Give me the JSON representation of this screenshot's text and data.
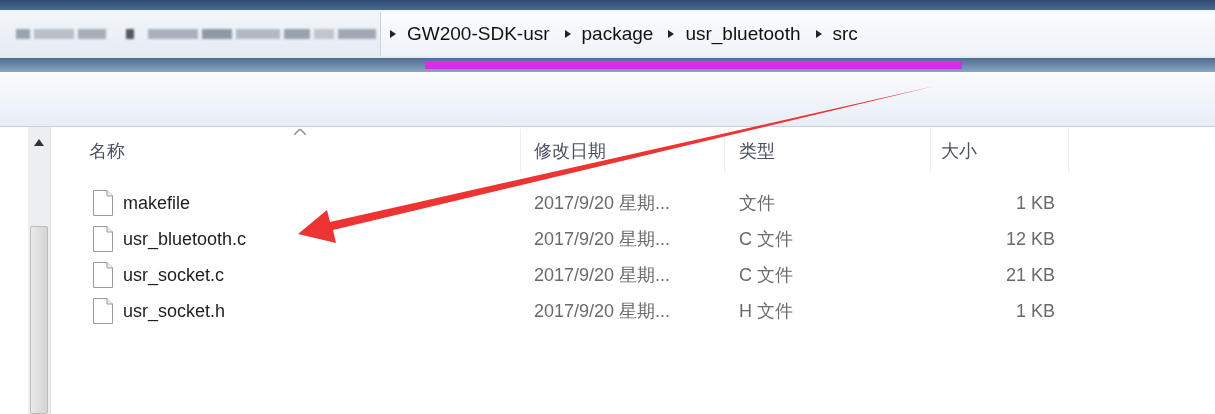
{
  "breadcrumbs": [
    "GW200-SDK-usr",
    "package",
    "usr_bluetooth",
    "src"
  ],
  "columns": [
    {
      "label": "名称",
      "sorted": true
    },
    {
      "label": "修改日期",
      "sorted": false
    },
    {
      "label": "类型",
      "sorted": false
    },
    {
      "label": "大小",
      "sorted": false
    }
  ],
  "files": [
    {
      "name": "makefile",
      "modified": "2017/9/20 星期...",
      "type": "文件",
      "size": "1 KB"
    },
    {
      "name": "usr_bluetooth.c",
      "modified": "2017/9/20 星期...",
      "type": "C 文件",
      "size": "12 KB"
    },
    {
      "name": "usr_socket.c",
      "modified": "2017/9/20 星期...",
      "type": "C 文件",
      "size": "21 KB"
    },
    {
      "name": "usr_socket.h",
      "modified": "2017/9/20 星期...",
      "type": "H 文件",
      "size": "1 KB"
    }
  ]
}
